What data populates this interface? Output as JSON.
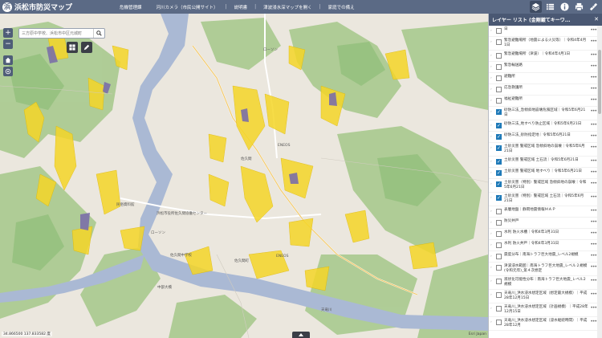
{
  "header": {
    "title": "浜松市防災マップ",
    "nav": [
      "危機管理課",
      "河川カメラ（市民公開サイト）",
      "説明書",
      "津波浸水深マップを開く",
      "家庭での備え"
    ]
  },
  "toolbar_icons": [
    "layers-icon",
    "list-icon",
    "info-icon",
    "print-icon",
    "measure-icon"
  ],
  "search": {
    "placeholder": "三方原中学校、浜松市中区元城町",
    "value": ""
  },
  "map": {
    "coords": "34.866500 137.833582 度",
    "attribution": "Esri Japan",
    "labels": [
      "ローソン",
      "ENEOS",
      "佐久間",
      "ENEOS",
      "佐久間町",
      "佐久間中学校",
      "中部大橋",
      "ローソン",
      "民俗資料館",
      "浜松市役所佐久間協働センター",
      "天竜川"
    ],
    "colors": {
      "hazard_yellow": "#f5d628",
      "hazard_purple": "#7b6fa8",
      "river": "#aab9d4",
      "forest": "#a7c98b"
    }
  },
  "layer_panel": {
    "title": "レイヤー リスト (金剛鍍てキーワ...",
    "layers": [
      {
        "label": "日",
        "checked": false
      },
      {
        "label": "緊急避難場所（地震による火災等）｜令和4年4月1日",
        "checked": false
      },
      {
        "label": "緊急避難場所（津波）｜令和4年4月1日",
        "checked": false
      },
      {
        "label": "緊急輸送路",
        "checked": false
      },
      {
        "label": "避難所",
        "checked": false
      },
      {
        "label": "応急救護所",
        "checked": false
      },
      {
        "label": "福祉避難所",
        "checked": false
      },
      {
        "label": "砂防三法_急傾斜地崩壊危険区域｜令和5年6月21日",
        "checked": true
      },
      {
        "label": "砂防三法_地すべり防止区域｜令和5年6月21日",
        "checked": true
      },
      {
        "label": "砂防三法_砂防指定地｜令和5年6月21日",
        "checked": true
      },
      {
        "label": "土砂災害 警戒区域 急傾斜地の崩壊｜令和5年6月21日",
        "checked": true
      },
      {
        "label": "土砂災害 警戒区域 土石流｜令和5年6月21日",
        "checked": true
      },
      {
        "label": "土砂災害 警戒区域 地すべり｜令和5年6月21日",
        "checked": true
      },
      {
        "label": "土砂災害（特別）警戒区域 急傾斜地の崩壊｜令和5年6月21日",
        "checked": true
      },
      {
        "label": "土砂災害（特別）警戒区域 土石流｜令和5年6月21日",
        "checked": true
      },
      {
        "label": "表層地盤｜静岡地震情報ＭＡＰ",
        "checked": false
      },
      {
        "label": "防災井戸",
        "checked": false
      },
      {
        "label": "水利 防火水槽｜令和4年3月31日",
        "checked": false
      },
      {
        "label": "水利 防火井戸｜令和4年3月31日",
        "checked": false
      },
      {
        "label": "震度分布｜南海トラフ巨大地震_レベル2規模",
        "checked": false
      },
      {
        "label": "津波浸水範囲｜南海トラフ巨大地震_レベル２規模(令和元年)_第４次想定",
        "checked": false
      },
      {
        "label": "液状化可能性分布｜南海トラフ巨大地震_レベル2規模",
        "checked": false
      },
      {
        "label": "天竜川_洪水浸水想定区域（想定最大規模）｜平成28年12月15日",
        "checked": false
      },
      {
        "label": "天竜川_洪水浸水想定区域（計画規模）｜平成28年12月15日",
        "checked": false
      },
      {
        "label": "天竜川_洪水浸水想定区域（浸水継続時間）｜平成28年12月",
        "checked": false
      }
    ]
  }
}
